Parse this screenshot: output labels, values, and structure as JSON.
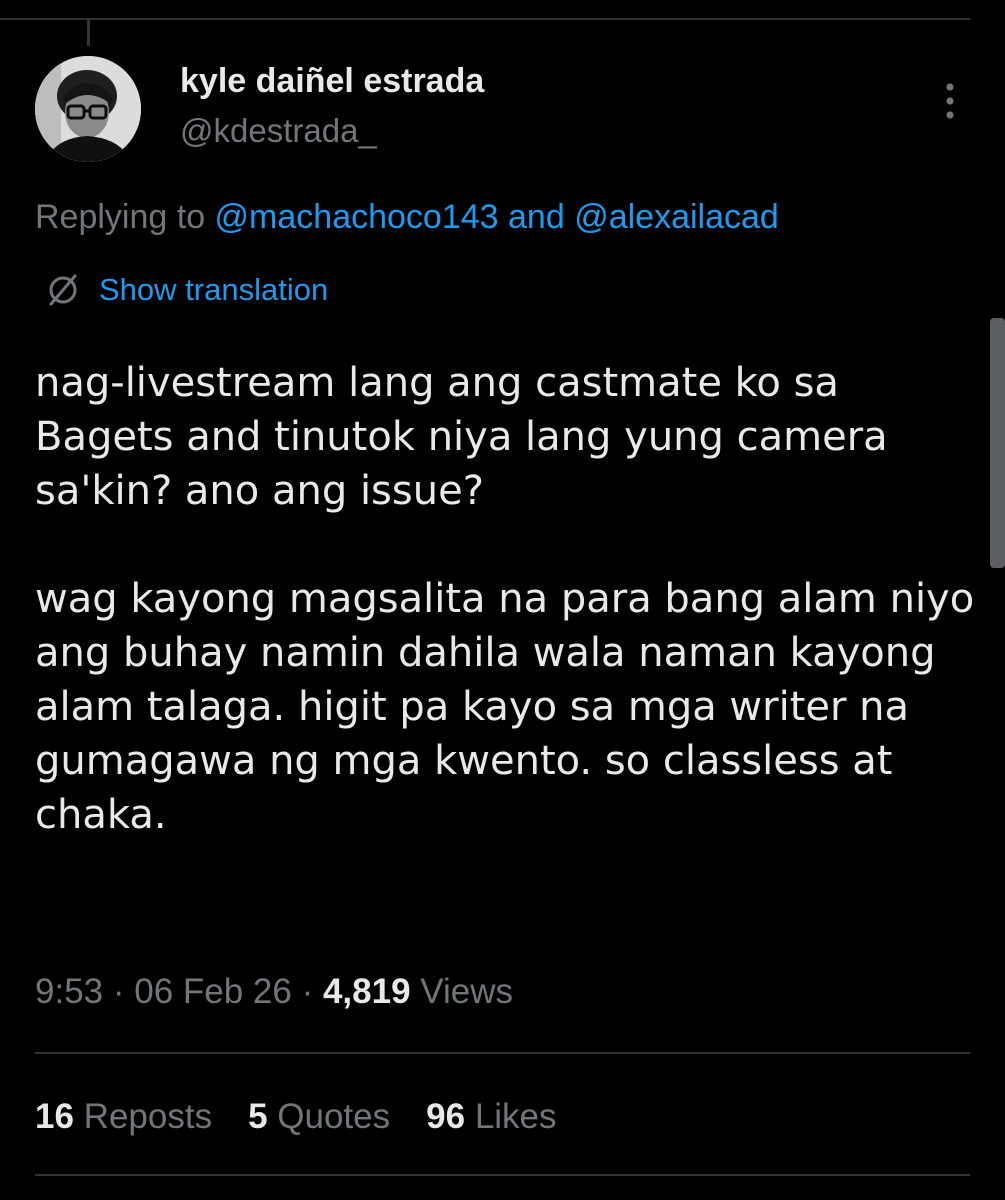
{
  "author": {
    "display_name": "kyle daiñel estrada",
    "handle": "@kdestrada_",
    "avatar_icon": "profile-photo"
  },
  "reply": {
    "prefix": "Replying to ",
    "mention_1": "@machachoco143",
    "conjunction": " and ",
    "mention_2": "@alexailacad"
  },
  "translation": {
    "label": "Show translation",
    "icon": "globe-slash-icon"
  },
  "tweet": {
    "paragraph_1": "nag-livestream lang ang castmate ko sa Bagets and tinutok niya lang yung camera sa'kin? ano ang issue?",
    "paragraph_2": "wag kayong magsalita na para bang alam niyo ang buhay namin dahila wala naman kayong alam talaga. higit pa kayo sa mga writer na gumagawa ng mga kwento. so classless at chaka."
  },
  "meta": {
    "time": "9:53",
    "separator": " · ",
    "date": "06 Feb 26",
    "views_count": "4,819",
    "views_label": "Views"
  },
  "stats": [
    {
      "count": "16",
      "label": "Reposts"
    },
    {
      "count": "5",
      "label": "Quotes"
    },
    {
      "count": "96",
      "label": "Likes"
    }
  ],
  "colors": {
    "background": "#000000",
    "text": "#e7e9ea",
    "secondary": "#71767b",
    "accent": "#1d9bf0",
    "divider": "#2f3336"
  }
}
